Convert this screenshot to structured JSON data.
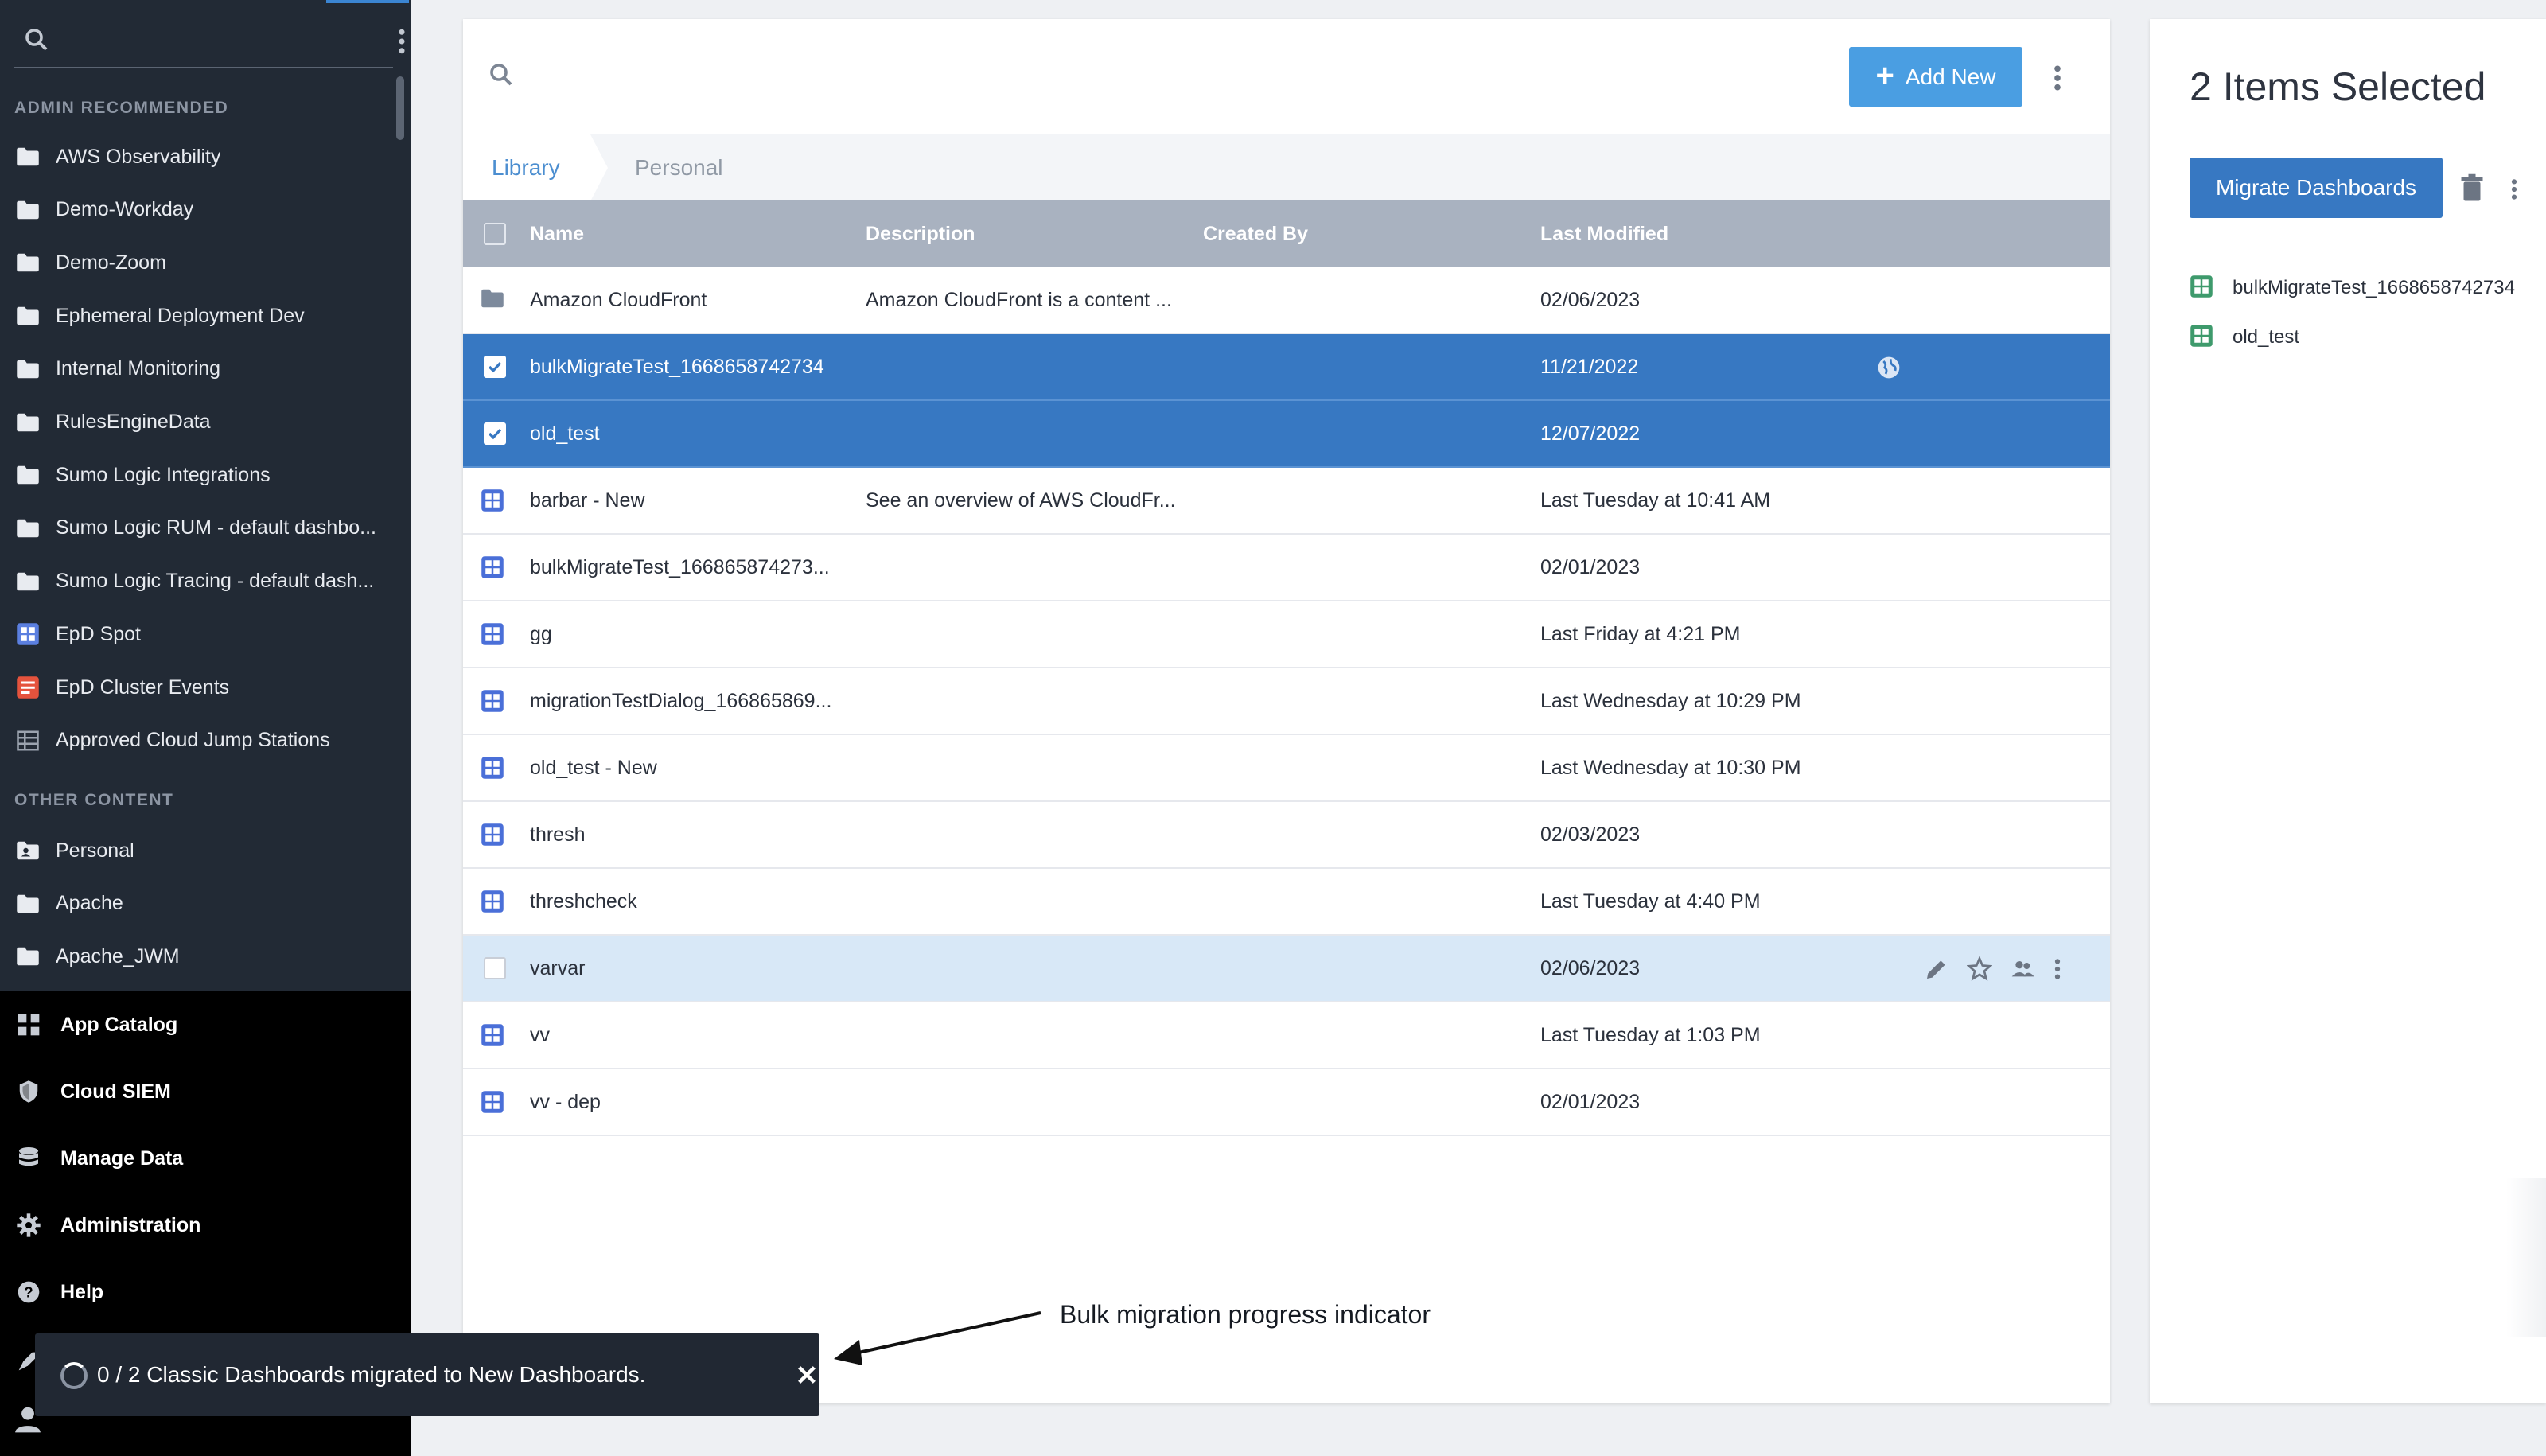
{
  "sidebar": {
    "search_placeholder": "",
    "admin_section": "ADMIN RECOMMENDED",
    "admin_items": [
      {
        "label": "AWS Observability",
        "icon": "folder-icon"
      },
      {
        "label": "Demo-Workday",
        "icon": "folder-icon"
      },
      {
        "label": "Demo-Zoom",
        "icon": "folder-icon"
      },
      {
        "label": "Ephemeral Deployment Dev",
        "icon": "folder-icon"
      },
      {
        "label": "Internal Monitoring",
        "icon": "folder-icon"
      },
      {
        "label": "RulesEngineData",
        "icon": "folder-icon"
      },
      {
        "label": "Sumo Logic Integrations",
        "icon": "folder-icon"
      },
      {
        "label": "Sumo Logic RUM - default dashbo...",
        "icon": "folder-icon"
      },
      {
        "label": "Sumo Logic Tracing - default dash...",
        "icon": "folder-icon"
      },
      {
        "label": "EpD Spot",
        "icon": "dashboard-icon"
      },
      {
        "label": "EpD Cluster Events",
        "icon": "search-report-icon"
      },
      {
        "label": "Approved Cloud Jump Stations",
        "icon": "table-icon"
      }
    ],
    "other_section": "OTHER CONTENT",
    "other_items": [
      {
        "label": "Personal",
        "icon": "personal-folder-icon"
      },
      {
        "label": "Apache",
        "icon": "folder-icon"
      },
      {
        "label": "Apache_JWM",
        "icon": "folder-icon"
      }
    ],
    "nav": [
      {
        "label": "App Catalog",
        "icon": "app-grid-icon"
      },
      {
        "label": "Cloud SIEM",
        "icon": "shield-icon"
      },
      {
        "label": "Manage Data",
        "icon": "database-icon"
      },
      {
        "label": "Administration",
        "icon": "gear-icon"
      },
      {
        "label": "Help",
        "icon": "help-icon"
      }
    ]
  },
  "toolbar": {
    "search_placeholder": "",
    "add_new_label": "Add New"
  },
  "breadcrumb": {
    "library": "Library",
    "personal": "Personal"
  },
  "table": {
    "columns": {
      "name": "Name",
      "description": "Description",
      "created_by": "Created By",
      "last_modified": "Last Modified"
    },
    "rows": [
      {
        "name": "Amazon CloudFront",
        "description": "Amazon CloudFront is a content ...",
        "created_by": "",
        "modified": "02/06/2023",
        "icon": "folder-icon",
        "state": "normal"
      },
      {
        "name": "bulkMigrateTest_1668658742734",
        "description": "",
        "created_by": "",
        "modified": "11/21/2022",
        "icon": "dashboard-icon",
        "state": "selected",
        "shared": true
      },
      {
        "name": "old_test",
        "description": "",
        "created_by": "",
        "modified": "12/07/2022",
        "icon": "dashboard-icon",
        "state": "selected"
      },
      {
        "name": "barbar - New",
        "description": "See an overview of AWS CloudFr...",
        "created_by": "",
        "modified": "Last Tuesday at 10:41 AM",
        "icon": "dashboard-icon",
        "state": "normal"
      },
      {
        "name": "bulkMigrateTest_166865874273...",
        "description": "",
        "created_by": "",
        "modified": "02/01/2023",
        "icon": "dashboard-icon",
        "state": "normal"
      },
      {
        "name": "gg",
        "description": "",
        "created_by": "",
        "modified": "Last Friday at 4:21 PM",
        "icon": "dashboard-icon",
        "state": "normal"
      },
      {
        "name": "migrationTestDialog_166865869...",
        "description": "",
        "created_by": "",
        "modified": "Last Wednesday at 10:29 PM",
        "icon": "dashboard-icon",
        "state": "normal"
      },
      {
        "name": "old_test - New",
        "description": "",
        "created_by": "",
        "modified": "Last Wednesday at 10:30 PM",
        "icon": "dashboard-icon",
        "state": "normal"
      },
      {
        "name": "thresh",
        "description": "",
        "created_by": "",
        "modified": "02/03/2023",
        "icon": "dashboard-icon",
        "state": "normal"
      },
      {
        "name": "threshcheck",
        "description": "",
        "created_by": "",
        "modified": "Last Tuesday at 4:40 PM",
        "icon": "dashboard-icon",
        "state": "normal"
      },
      {
        "name": "varvar",
        "description": "",
        "created_by": "",
        "modified": "02/06/2023",
        "icon": "dashboard-icon",
        "state": "hover"
      },
      {
        "name": "vv",
        "description": "",
        "created_by": "",
        "modified": "Last Tuesday at 1:03 PM",
        "icon": "dashboard-icon",
        "state": "normal"
      },
      {
        "name": "vv - dep",
        "description": "",
        "created_by": "",
        "modified": "02/01/2023",
        "icon": "dashboard-icon",
        "state": "normal"
      }
    ]
  },
  "detail": {
    "title": "2 Items Selected",
    "migrate_label": "Migrate Dashboards",
    "items": [
      "bulkMigrateTest_1668658742734",
      "old_test"
    ]
  },
  "toast": {
    "message": "0 / 2 Classic Dashboards migrated to New Dashboards."
  },
  "annotation": {
    "text": "Bulk migration progress indicator"
  },
  "colors": {
    "sidebar_bg": "#222a35",
    "sidebar_bottom_bg": "#000000",
    "accent": "#4a9ee2",
    "selected_row": "#3778c2",
    "hover_row": "#d8e8f7",
    "header_row": "#a9b2c0",
    "dashboard_icon": "#4a6fd8",
    "detail_icon": "#3e9a6c",
    "report_icon": "#e5533d"
  }
}
